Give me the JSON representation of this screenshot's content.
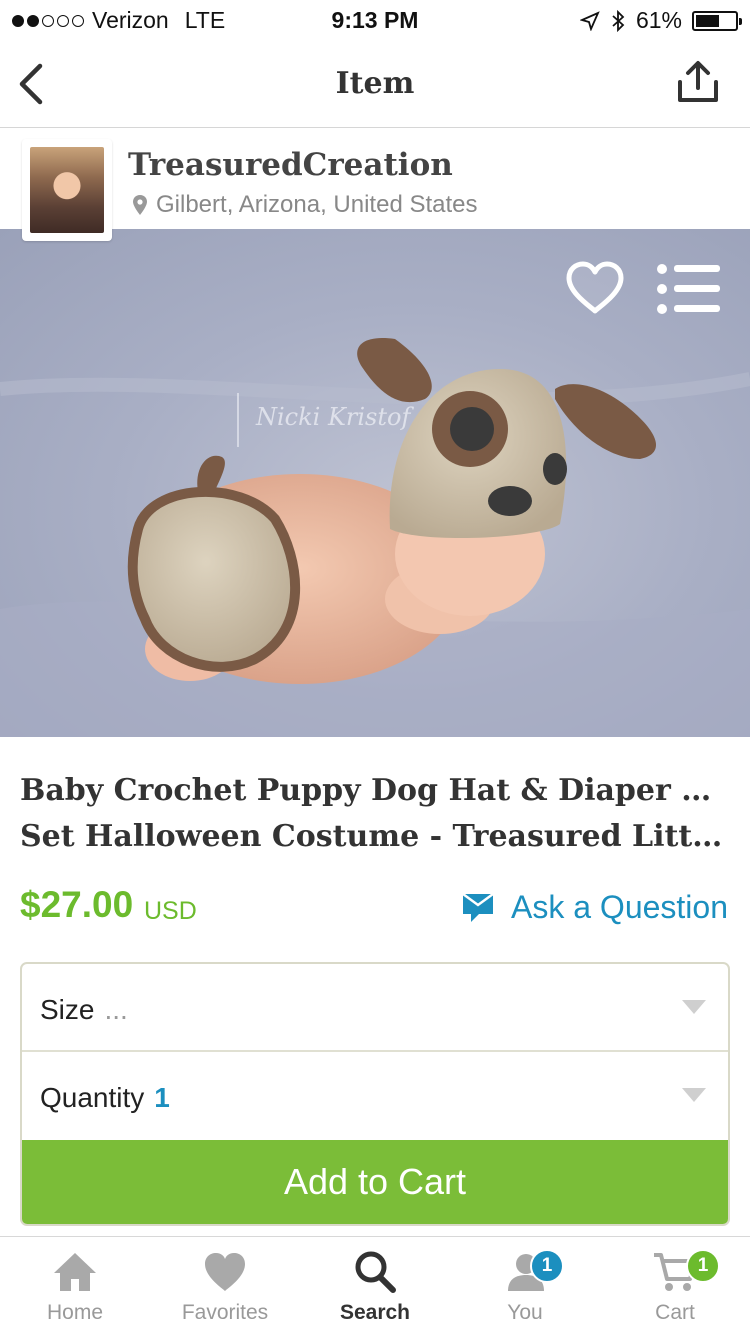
{
  "status_bar": {
    "carrier": "Verizon",
    "network": "LTE",
    "signal_bars_filled": 2,
    "signal_bars_total": 5,
    "time": "9:13 PM",
    "battery": "61%",
    "battery_level": 0.61
  },
  "nav": {
    "title": "Item",
    "back_icon": "chevron-left-icon",
    "share_icon": "share-icon"
  },
  "shop": {
    "name": "TreasuredCreation",
    "location": "Gilbert, Arizona, United States",
    "location_icon": "location-pin-icon"
  },
  "photo": {
    "watermark": "Nicki Kristof",
    "favorite_icon": "heart-outline-icon",
    "list_icon": "list-icon"
  },
  "item": {
    "title_line1": "Baby Crochet Puppy Dog Hat & Diaper Cover",
    "title_line2": "Set Halloween Costume - Treasured Little Cre...",
    "price": "$27.00",
    "currency": "USD",
    "ask_label": "Ask a Question"
  },
  "options": {
    "size_label": "Size",
    "size_value": "...",
    "quantity_label": "Quantity",
    "quantity_value": "1",
    "add_to_cart": "Add to Cart"
  },
  "tabs": [
    {
      "label": "Home",
      "icon": "home-icon"
    },
    {
      "label": "Favorites",
      "icon": "heart-icon"
    },
    {
      "label": "Search",
      "icon": "search-icon",
      "active": true
    },
    {
      "label": "You",
      "icon": "user-icon",
      "badge": "1"
    },
    {
      "label": "Cart",
      "icon": "cart-icon",
      "badge": "1"
    }
  ],
  "colors": {
    "green": "#7bbd38",
    "price_green": "#6cbb2d",
    "link_blue": "#1c8fbf",
    "badge_blue": "#1c8fbf",
    "badge_green": "#6cbb2d"
  }
}
